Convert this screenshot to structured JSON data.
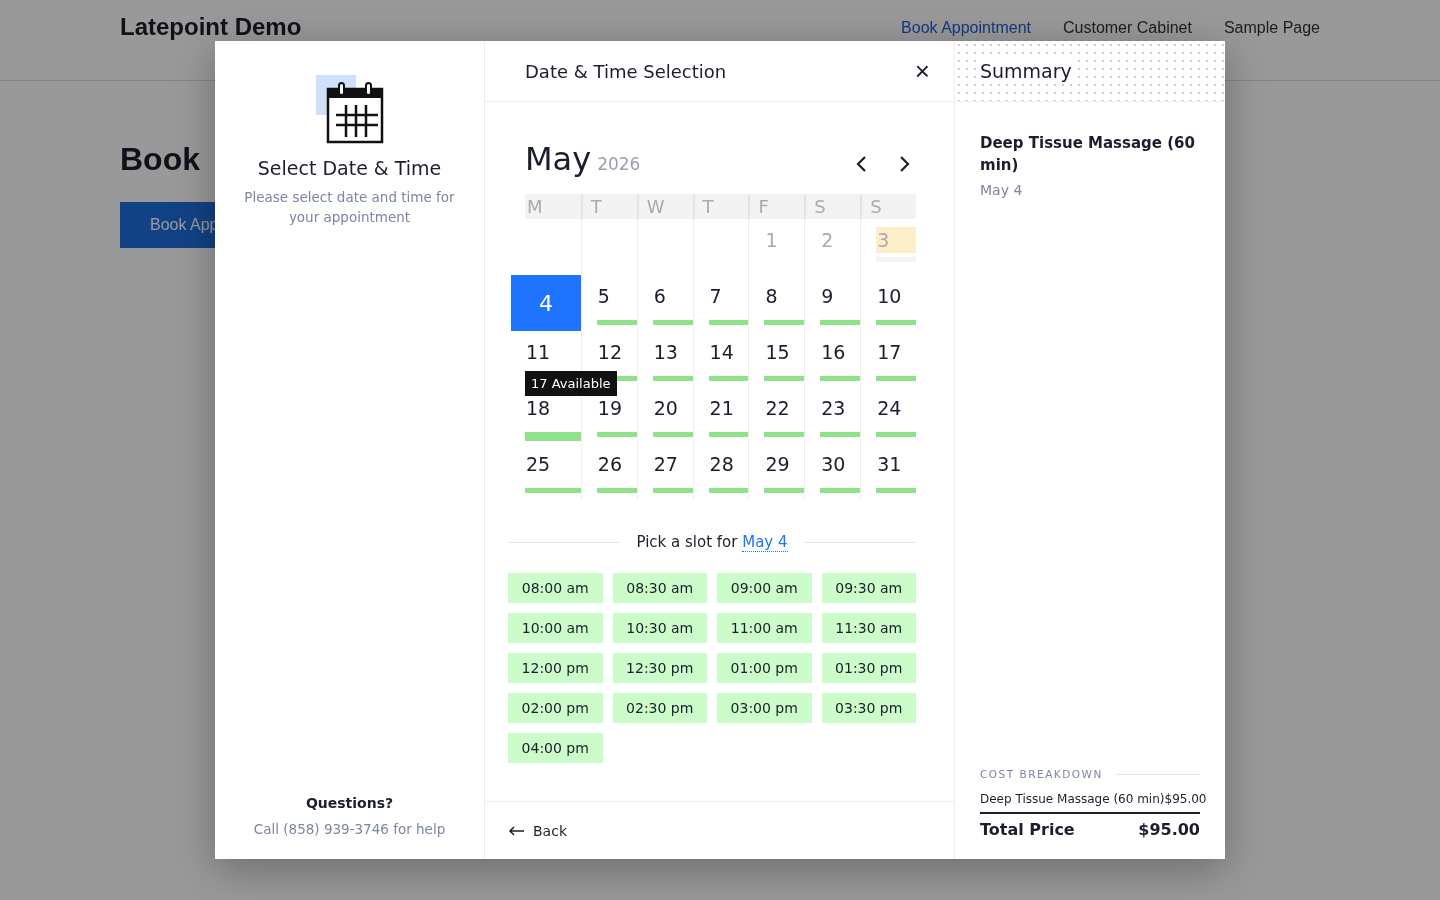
{
  "site": {
    "title": "Latepoint Demo",
    "nav": [
      {
        "label": "Book Appointment",
        "selected": true
      },
      {
        "label": "Customer Cabinet",
        "selected": false
      },
      {
        "label": "Sample Page",
        "selected": false
      }
    ],
    "heading": "Book",
    "button": "Book App"
  },
  "sidebar": {
    "title": "Select Date & Time",
    "description": "Please select date and time for your appointment",
    "questions": "Questions?",
    "help": "Call (858) 939-3746 for help"
  },
  "step": {
    "title": "Date & Time Selection",
    "close": "×"
  },
  "calendar": {
    "month": "May",
    "year": "2026",
    "weekdays": [
      "M",
      "T",
      "W",
      "T",
      "F",
      "S",
      "S"
    ],
    "weeks": [
      [
        {
          "kind": "blank"
        },
        {
          "kind": "blank"
        },
        {
          "kind": "blank"
        },
        {
          "kind": "blank"
        },
        {
          "kind": "past",
          "day": "1",
          "selected": false
        },
        {
          "kind": "past",
          "day": "2",
          "selected": false
        },
        {
          "kind": "today",
          "day": "3",
          "selected": false
        }
      ],
      [
        {
          "kind": "available",
          "day": "4",
          "selected": true
        },
        {
          "kind": "available",
          "day": "5",
          "selected": false
        },
        {
          "kind": "available",
          "day": "6",
          "selected": false
        },
        {
          "kind": "available",
          "day": "7",
          "selected": false
        },
        {
          "kind": "available",
          "day": "8",
          "selected": false
        },
        {
          "kind": "available",
          "day": "9",
          "selected": false
        },
        {
          "kind": "available",
          "day": "10",
          "selected": false
        }
      ],
      [
        {
          "kind": "available",
          "day": "11",
          "selected": false
        },
        {
          "kind": "available",
          "day": "12",
          "selected": false
        },
        {
          "kind": "available",
          "day": "13",
          "selected": false
        },
        {
          "kind": "available",
          "day": "14",
          "selected": false
        },
        {
          "kind": "available",
          "day": "15",
          "selected": false
        },
        {
          "kind": "available",
          "day": "16",
          "selected": false
        },
        {
          "kind": "available",
          "day": "17",
          "selected": false
        }
      ],
      [
        {
          "kind": "available",
          "day": "18",
          "selected": false,
          "tooltip": "17 Available"
        },
        {
          "kind": "available",
          "day": "19",
          "selected": false
        },
        {
          "kind": "available",
          "day": "20",
          "selected": false
        },
        {
          "kind": "available",
          "day": "21",
          "selected": false
        },
        {
          "kind": "available",
          "day": "22",
          "selected": false
        },
        {
          "kind": "available",
          "day": "23",
          "selected": false
        },
        {
          "kind": "available",
          "day": "24",
          "selected": false
        }
      ],
      [
        {
          "kind": "available",
          "day": "25",
          "selected": false
        },
        {
          "kind": "available",
          "day": "26",
          "selected": false
        },
        {
          "kind": "available",
          "day": "27",
          "selected": false
        },
        {
          "kind": "available",
          "day": "28",
          "selected": false
        },
        {
          "kind": "available",
          "day": "29",
          "selected": false
        },
        {
          "kind": "available",
          "day": "30",
          "selected": false
        },
        {
          "kind": "available",
          "day": "31",
          "selected": false
        }
      ]
    ]
  },
  "slots": {
    "label": "Pick a slot for",
    "date": "May 4",
    "times": [
      "08:00 am",
      "08:30 am",
      "09:00 am",
      "09:30 am",
      "10:00 am",
      "10:30 am",
      "11:00 am",
      "11:30 am",
      "12:00 pm",
      "12:30 pm",
      "01:00 pm",
      "01:30 pm",
      "02:00 pm",
      "02:30 pm",
      "03:00 pm",
      "03:30 pm",
      "04:00 pm"
    ]
  },
  "back": "Back",
  "summary": {
    "title": "Summary",
    "service": "Deep Tissue Massage (60 min)",
    "date": "May 4",
    "breakdown_title": "COST BREAKDOWN",
    "items": [
      {
        "name": "Deep Tissue Massage (60 min)",
        "price": "$95.00"
      }
    ],
    "total_label": "Total Price",
    "total": "$95.00"
  }
}
